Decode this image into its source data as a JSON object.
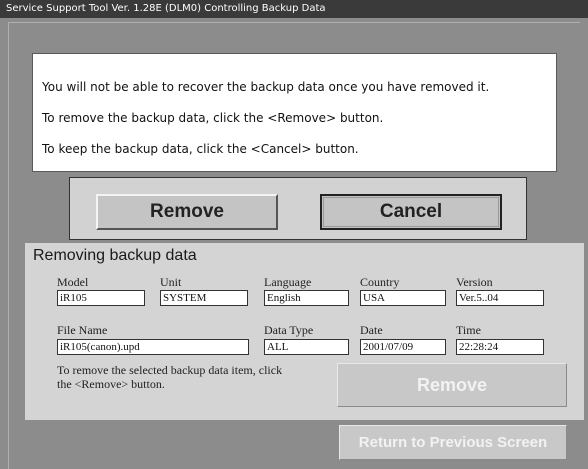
{
  "window": {
    "title": "Service Support Tool Ver. 1.28E (DLM0)   Controlling Backup Data"
  },
  "confirm": {
    "line1": "You will not be able to recover the backup data once you have removed it.",
    "line2": "To remove the backup data, click the <Remove> button.",
    "line3": "To keep the backup data, click the <Cancel> button."
  },
  "buttons": {
    "remove_label": "Remove",
    "cancel_label": "Cancel",
    "remove_item_label": "Remove",
    "return_label": "Return to Previous Screen"
  },
  "info": {
    "title": "Removing backup data",
    "fields": {
      "model": {
        "label": "Model",
        "value": "iR105"
      },
      "unit": {
        "label": "Unit",
        "value": "SYSTEM"
      },
      "language": {
        "label": "Language",
        "value": "English"
      },
      "country": {
        "label": "Country",
        "value": "USA"
      },
      "version": {
        "label": "Version",
        "value": "Ver.5..04"
      },
      "file_name": {
        "label": "File Name",
        "value": "iR105(canon).upd"
      },
      "data_type": {
        "label": "Data Type",
        "value": "ALL"
      },
      "date": {
        "label": "Date",
        "value": "2001/07/09"
      },
      "time": {
        "label": "Time",
        "value": "22:28:24"
      }
    },
    "note_line1": "To remove the selected backup data item, click",
    "note_line2": "the <Remove> button."
  },
  "colors": {
    "background": "#8c8c8c",
    "title_bar": "#3a3a3a",
    "panel": "#d4d4d4",
    "disabled_text": "#f2f2f2"
  }
}
